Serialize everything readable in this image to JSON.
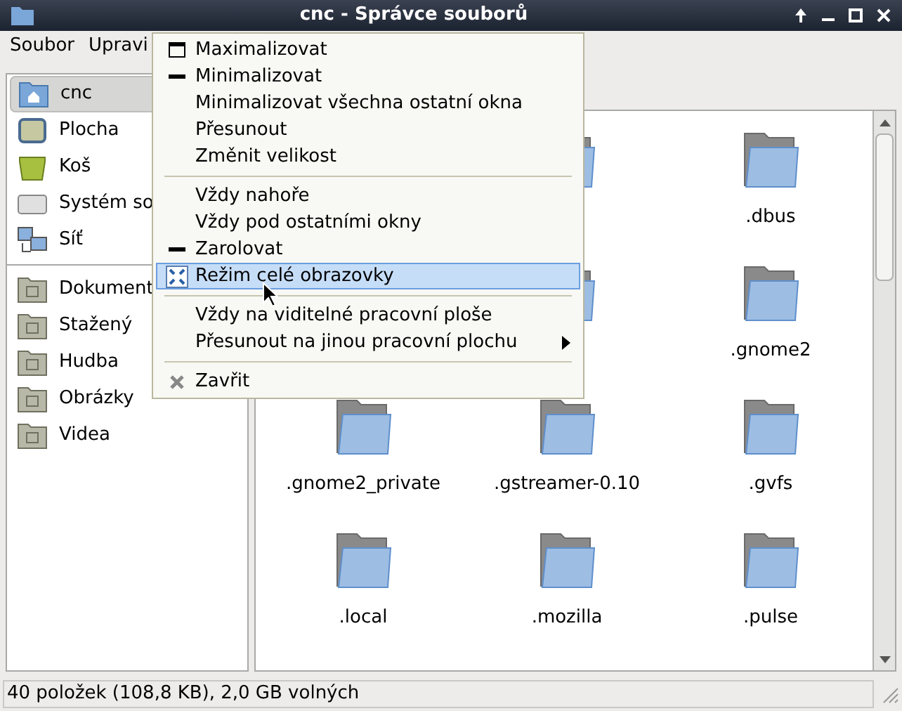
{
  "window": {
    "title": "cnc - Správce souborů"
  },
  "menubar": [
    {
      "label": "Soubor"
    },
    {
      "label": "Upravi"
    }
  ],
  "sidebar": {
    "groups": [
      {
        "items": [
          {
            "label": "cnc",
            "kind": "home",
            "selected": true
          },
          {
            "label": "Plocha",
            "kind": "desktop",
            "selected": false
          },
          {
            "label": "Koš",
            "kind": "trash",
            "selected": false
          },
          {
            "label": "Systém so",
            "kind": "drive",
            "selected": false
          },
          {
            "label": "Síť",
            "kind": "network",
            "selected": false
          }
        ]
      },
      {
        "items": [
          {
            "label": "Dokument",
            "kind": "folder",
            "selected": false
          },
          {
            "label": "Stažený",
            "kind": "folder",
            "selected": false
          },
          {
            "label": "Hudba",
            "kind": "folder",
            "selected": false
          },
          {
            "label": "Obrázky",
            "kind": "folder",
            "selected": false
          },
          {
            "label": "Videa",
            "kind": "folder",
            "selected": false
          }
        ]
      }
    ]
  },
  "files": [
    {
      "kind": "hidden"
    },
    {
      "kind": "covered"
    },
    {
      "kind": "folder",
      "name": ".dbus"
    },
    {
      "kind": "hidden"
    },
    {
      "kind": "covered"
    },
    {
      "kind": "folder",
      "name": ".gnome2"
    },
    {
      "kind": "folder",
      "name": ".gnome2_private"
    },
    {
      "kind": "folder",
      "name": ".gstreamer-0.10"
    },
    {
      "kind": "folder",
      "name": ".gvfs"
    },
    {
      "kind": "folder",
      "name": ".local"
    },
    {
      "kind": "folder",
      "name": ".mozilla"
    },
    {
      "kind": "folder",
      "name": ".pulse"
    }
  ],
  "window_menu": [
    {
      "kind": "maximize",
      "label": "Maximalizovat",
      "selected": false
    },
    {
      "kind": "minimize",
      "label": "Minimalizovat",
      "selected": false
    },
    {
      "kind": "plain",
      "label": "Minimalizovat všechna ostatní okna",
      "selected": false
    },
    {
      "kind": "plain",
      "label": "Přesunout",
      "selected": false
    },
    {
      "kind": "plain",
      "label": "Změnit velikost",
      "selected": false
    },
    {
      "kind": "separator"
    },
    {
      "kind": "plain",
      "label": "Vždy nahoře",
      "selected": false
    },
    {
      "kind": "plain",
      "label": "Vždy pod ostatními okny",
      "selected": false
    },
    {
      "kind": "minimize",
      "label": "Zarolovat",
      "selected": false
    },
    {
      "kind": "fullscreen",
      "label": "Režim celé obrazovky",
      "selected": true
    },
    {
      "kind": "separator"
    },
    {
      "kind": "plain",
      "label": "Vždy na viditelné pracovní ploše",
      "selected": false
    },
    {
      "kind": "submenu",
      "label": "Přesunout na jinou pracovní plochu",
      "selected": false
    },
    {
      "kind": "separator"
    },
    {
      "kind": "close",
      "label": "Zavřit",
      "selected": false
    }
  ],
  "status_bar": "40 položek (108,8 KB), 2,0 GB volných"
}
